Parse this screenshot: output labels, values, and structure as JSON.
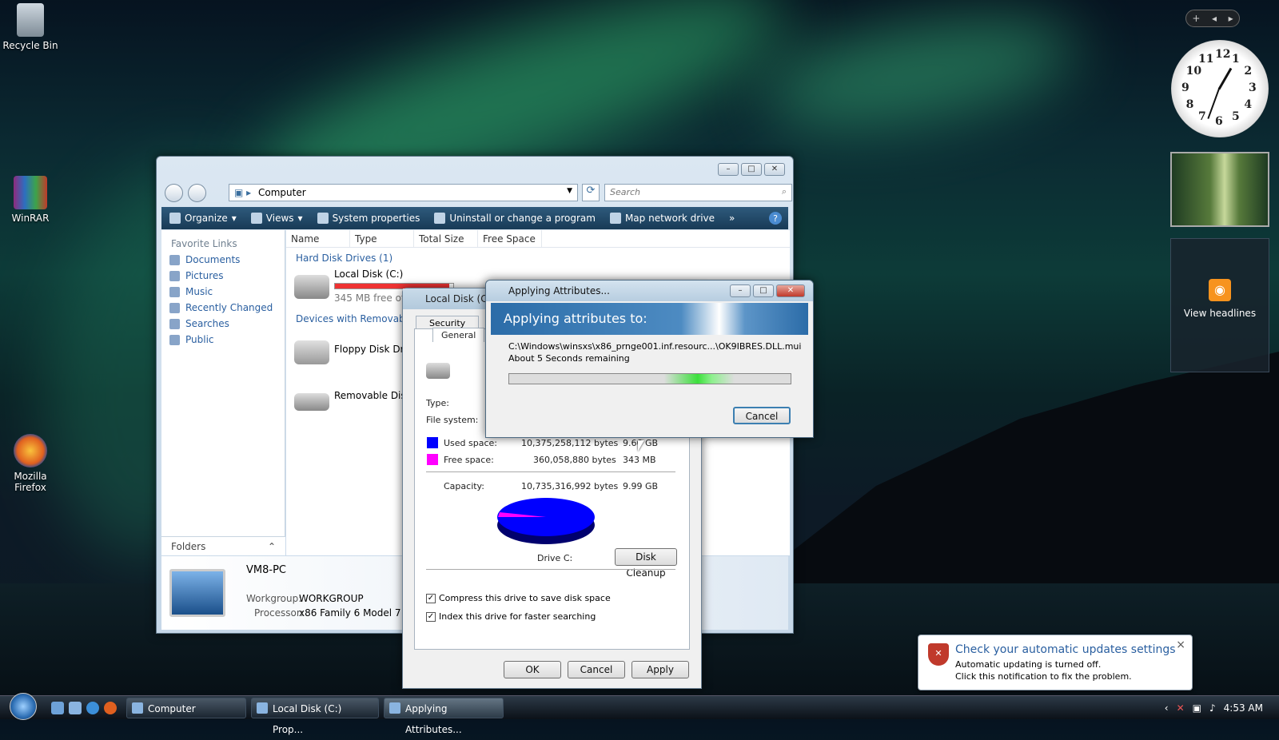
{
  "desktop": {
    "icons": [
      "Recycle Bin",
      "WinRAR",
      "Mozilla Firefox"
    ]
  },
  "gadgets": {
    "add": "+",
    "prev": "◂",
    "next": "▸",
    "clock_numbers": [
      "12",
      "1",
      "2",
      "3",
      "4",
      "5",
      "6",
      "7",
      "8",
      "9",
      "10",
      "11"
    ],
    "rss_label": "View headlines"
  },
  "explorer": {
    "address": "Computer",
    "search_placeholder": "Search",
    "toolbar": {
      "organize": "Organize",
      "views": "Views",
      "system_properties": "System properties",
      "uninstall": "Uninstall or change a program",
      "map_drive": "Map network drive",
      "more": "»",
      "help": "?"
    },
    "favorite_links_header": "Favorite Links",
    "links": [
      "Documents",
      "Pictures",
      "Music",
      "Recently Changed",
      "Searches",
      "Public"
    ],
    "folders_label": "Folders",
    "columns": [
      "Name",
      "Type",
      "Total Size",
      "Free Space"
    ],
    "group_hdd": "Hard Disk Drives (1)",
    "local_disk": "Local Disk (C:)",
    "local_disk_free": "345 MB free of 9",
    "local_disk_used_fraction": 0.966,
    "group_removable": "Devices with Removable",
    "floppy": "Floppy Disk Dri",
    "removable": "Removable Disk",
    "details": {
      "name": "VM8-PC",
      "workgroup_label": "Workgroup:",
      "workgroup": "WORKGROUP",
      "processor_label": "Processor:",
      "processor": "x86 Family 6 Model 7 St..."
    }
  },
  "props": {
    "title": "Local Disk (C:",
    "tabs": [
      "Security",
      "General"
    ],
    "type_label": "Type:",
    "fs_label": "File system:",
    "used_label": "Used space:",
    "used_bytes": "10,375,258,112 bytes",
    "used_gb": "9.66 GB",
    "free_label": "Free space:",
    "free_bytes": "360,058,880 bytes",
    "free_mb": "343 MB",
    "capacity_label": "Capacity:",
    "capacity_bytes": "10,735,316,992 bytes",
    "capacity_gb": "9.99 GB",
    "drive_label": "Drive C:",
    "disk_cleanup": "Disk Cleanup",
    "compress": "Compress this drive to save disk space",
    "index": "Index this drive for faster searching",
    "ok": "OK",
    "cancel": "Cancel",
    "apply": "Apply",
    "colors": {
      "used": "#0000ff",
      "free": "#ff00ff"
    }
  },
  "apply_dialog": {
    "title": "Applying Attributes...",
    "heading": "Applying attributes to:",
    "path": "C:\\Windows\\winsxs\\x86_prnge001.inf.resourc...\\OK9IBRES.DLL.mui",
    "remaining": "About 5 Seconds remaining",
    "cancel": "Cancel"
  },
  "notification": {
    "title": "Check your automatic updates settings",
    "line1": "Automatic updating is turned off.",
    "line2": "Click this notification to fix the problem.",
    "close": "×"
  },
  "taskbar": {
    "tasks": [
      "Computer",
      "Local Disk (C:) Prop...",
      "Applying Attributes..."
    ],
    "time": "4:53 AM"
  }
}
